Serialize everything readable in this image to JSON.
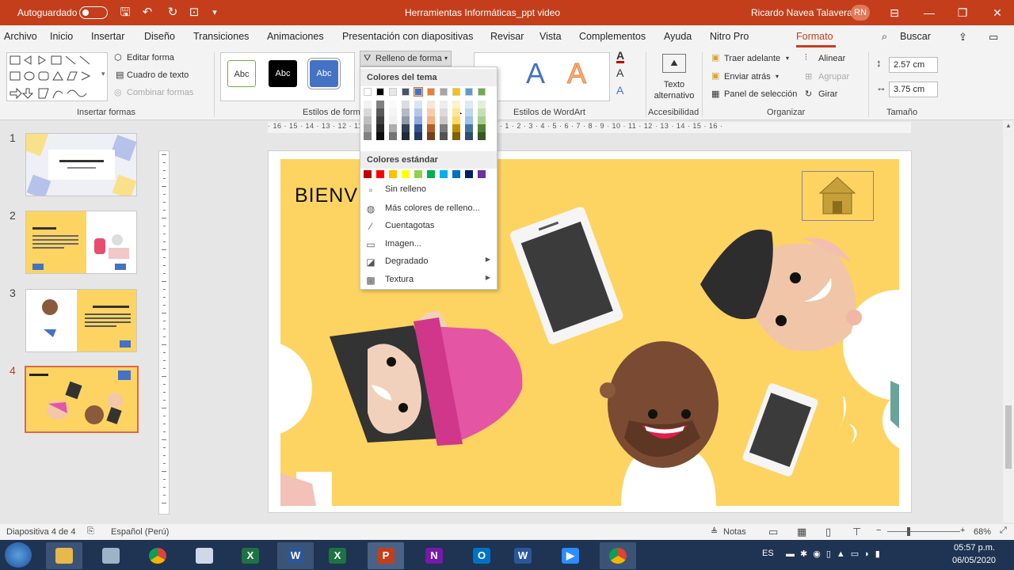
{
  "titlebar": {
    "autosave_label": "Autoguardado",
    "doc_title": "Herramientas Informáticas_ppt video",
    "user_name": "Ricardo Navea Talavera",
    "user_initials": "RN"
  },
  "tabs": [
    "Archivo",
    "Inicio",
    "Insertar",
    "Diseño",
    "Transiciones",
    "Animaciones",
    "Presentación con diapositivas",
    "Revisar",
    "Vista",
    "Complementos",
    "Ayuda",
    "Nitro Pro",
    "Formato"
  ],
  "active_tab": "Formato",
  "search_label": "Buscar",
  "ribbon": {
    "edit_shape": "Editar forma",
    "text_box": "Cuadro de texto",
    "merge_shapes": "Combinar formas",
    "insert_shapes_label": "Insertar formas",
    "style_sample": "Abc",
    "shape_styles_label": "Estilos de form",
    "shape_fill": "Relleno de forma",
    "wordart_letter": "A",
    "wordart_label": "Estilos de WordArt",
    "alt_text": "Texto alternativo",
    "accessibility_label": "Accesibilidad",
    "bring_forward": "Traer adelante",
    "send_backward": "Enviar atrás",
    "selection_pane": "Panel de selección",
    "align": "Alinear",
    "group": "Agrupar",
    "rotate": "Girar",
    "arrange_label": "Organizar",
    "height": "2.57 cm",
    "width": "3.75 cm",
    "size_label": "Tamaño"
  },
  "fill_menu": {
    "theme_colors_header": "Colores del tema",
    "standard_colors_header": "Colores estándar",
    "theme_colors": [
      "#ffffff",
      "#000000",
      "#e7e6e6",
      "#44546a",
      "#4472c4",
      "#ed7d31",
      "#a5a5a5",
      "#ffc000",
      "#5b9bd5",
      "#70ad47"
    ],
    "standard_colors": [
      "#c00000",
      "#ff0000",
      "#ffc000",
      "#ffff00",
      "#92d050",
      "#00b050",
      "#00b0f0",
      "#0070c0",
      "#002060",
      "#7030a0"
    ],
    "no_fill": "Sin relleno",
    "more_colors": "Más colores de relleno...",
    "eyedropper": "Cuentagotas",
    "picture": "Imagen...",
    "gradient": "Degradado",
    "texture": "Textura"
  },
  "slides": [
    {
      "number": "1"
    },
    {
      "number": "2"
    },
    {
      "number": "3"
    },
    {
      "number": "4"
    }
  ],
  "slide": {
    "title": "BIENVE"
  },
  "ruler_text": "· 16 · 15 · 14 · 13 · 12 · 11 · 10 · 9 · 8 · 7 · 6 · 5 · 4 · 3 · 2 · 1 · 0 · 1 · 2 · 3 · 4 · 5 · 6 · 7 · 8 · 9 · 10 · 11 · 12 · 13 · 14 · 15 · 16 ·",
  "status": {
    "slide_info": "Diapositiva 4 de 4",
    "language": "Español (Perú)",
    "notes": "Notas",
    "zoom": "68%"
  },
  "taskbar": {
    "lang": "ES",
    "time": "05:57 p.m.",
    "date": "06/05/2020"
  },
  "colors": {
    "accent": "#c43e1c",
    "slide_bg": "#fdd462"
  }
}
